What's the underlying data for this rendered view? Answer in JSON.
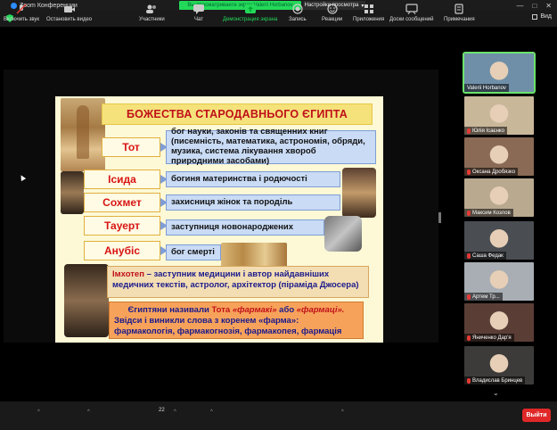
{
  "window": {
    "app_title": "Zoom Конференции",
    "share_banner": "Вы просматриваете экран Valerii Horbanov",
    "view_options": "Настройки просмотра",
    "view_button": "Вид",
    "minimize": "—",
    "maximize": "□",
    "close": "✕"
  },
  "slide": {
    "title": "БОЖЕСТВА СТАРОДАВНЬОГО ЄГИПТА",
    "gods": [
      {
        "name": "Тот",
        "desc": "бог науки, законів та священних книг (писемність, математика, астрономія, обряди, музика, система лікування хвороб природними засобами)"
      },
      {
        "name": "Ісида",
        "desc": "богиня материнства і родючості"
      },
      {
        "name": "Сохмет",
        "desc": "захисниця жінок та породіль"
      },
      {
        "name": "Тауерт",
        "desc": "заступниця новонароджених"
      },
      {
        "name": "Анубіс",
        "desc": "бог смерті"
      }
    ],
    "imhotep_name": "Імхотеп",
    "imhotep_text": " – заступник медицини і автор найдавніших медичних текстів, астролог, архітектор (піраміда Джосера)",
    "pharma_a": "Єгиптяни називали ",
    "pharma_tot": "Тота",
    "pharma_farmaki": "«фармакі»",
    "pharma_or": " або ",
    "pharma_farmaci": "«фармаці».",
    "pharma_line2": "Звідси і виникли слова з коренем «фарма»:",
    "pharma_line3": "фармакологія, фармакогнозія, фармакопея, фармація"
  },
  "gallery": [
    {
      "name": "Valerii Horbanov",
      "muted": false,
      "active": true,
      "bg": "#6f8fa8"
    },
    {
      "name": "Юлія Ісаєнко",
      "muted": true,
      "active": false,
      "bg": "#c9b79a"
    },
    {
      "name": "Оксана Дробязко",
      "muted": true,
      "active": false,
      "bg": "#8a6a55"
    },
    {
      "name": "Максим Козлов",
      "muted": true,
      "active": false,
      "bg": "#b9a98f"
    },
    {
      "name": "Саша Федак",
      "muted": true,
      "active": false,
      "bg": "#4a4e52"
    },
    {
      "name": "Артем Тр...",
      "muted": true,
      "active": false,
      "bg": "#a8aeb4"
    },
    {
      "name": "Яниченко Дар'я",
      "muted": true,
      "active": false,
      "bg": "#5a3e36"
    },
    {
      "name": "Владислав Бринцев",
      "muted": true,
      "active": false,
      "bg": "#3d3b39"
    }
  ],
  "toolbar": {
    "mute": "Включить звук",
    "video": "Остановить видео",
    "participants": "Участники",
    "participants_count": "22",
    "chat": "Чат",
    "share": "Демонстрация экрана",
    "record": "Запись",
    "reactions": "Реакции",
    "apps": "Приложения",
    "whiteboard": "Доски сообщений",
    "notes": "Примечания",
    "leave": "Выйти"
  },
  "colors": {
    "accent_green": "#23d959",
    "leave_red": "#e02828",
    "slide_bg": "#fdf9d6"
  }
}
